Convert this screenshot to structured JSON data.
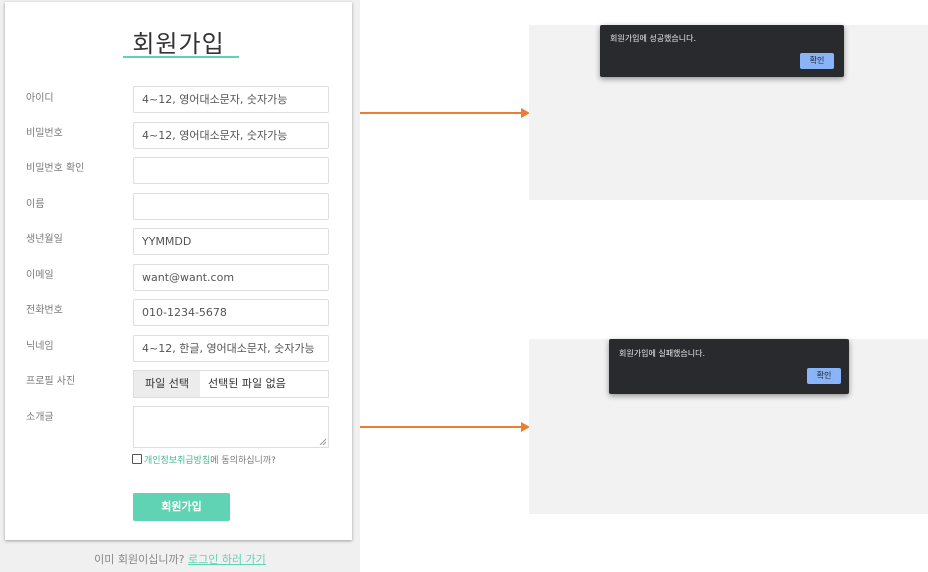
{
  "signup": {
    "title": "회원가입",
    "fields": [
      {
        "label": "아이디",
        "placeholder": "4~12, 영어대소문자, 숫자가능",
        "value": ""
      },
      {
        "label": "비밀번호",
        "placeholder": "4~12, 영어대소문자, 숫자가능",
        "value": ""
      },
      {
        "label": "비밀번호 확인",
        "placeholder": "",
        "value": ""
      },
      {
        "label": "이름",
        "placeholder": "",
        "value": ""
      },
      {
        "label": "생년월일",
        "placeholder": "YYMMDD",
        "value": ""
      },
      {
        "label": "이메일",
        "placeholder": "want@want.com",
        "value": ""
      },
      {
        "label": "전화번호",
        "placeholder": "010-1234-5678",
        "value": ""
      },
      {
        "label": "닉네임",
        "placeholder": "4~12, 한글, 영어대소문자, 숫자가능",
        "value": ""
      }
    ],
    "profile_label": "프로필 사진",
    "file_button": "파일 선택",
    "file_status": "선택된 파일 없음",
    "intro_label": "소개글",
    "agree_link": "개인정보취급방침",
    "agree_text": "에 동의하십니까?",
    "submit_label": "회원가입"
  },
  "footer": {
    "text": "이미 회원이십니까? ",
    "link": "로그인 하러 가기"
  },
  "dialogs": {
    "success": {
      "message": "회원가입에 성공했습니다.",
      "button": "확인"
    },
    "failure": {
      "message": "회원가입에 실패했습니다.",
      "button": "확인"
    }
  },
  "colors": {
    "accent": "#5fd3b3",
    "arrow": "#ed7d31",
    "dialog_bg": "#292a2d",
    "dialog_button": "#8ab4f8"
  }
}
